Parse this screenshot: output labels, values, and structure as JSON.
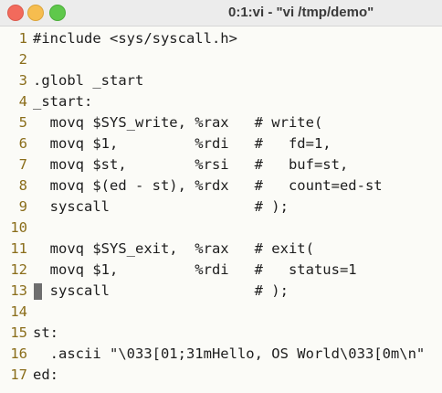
{
  "window": {
    "title": "0:1:vi - \"vi /tmp/demo\""
  },
  "editor": {
    "lines": [
      {
        "num": "1",
        "text": "#include <sys/syscall.h>"
      },
      {
        "num": "2",
        "text": ""
      },
      {
        "num": "3",
        "text": ".globl _start"
      },
      {
        "num": "4",
        "text": "_start:"
      },
      {
        "num": "5",
        "text": "  movq $SYS_write, %rax   # write("
      },
      {
        "num": "6",
        "text": "  movq $1,         %rdi   #   fd=1,"
      },
      {
        "num": "7",
        "text": "  movq $st,        %rsi   #   buf=st,"
      },
      {
        "num": "8",
        "text": "  movq $(ed - st), %rdx   #   count=ed-st"
      },
      {
        "num": "9",
        "text": "  syscall                 # );"
      },
      {
        "num": "10",
        "text": ""
      },
      {
        "num": "11",
        "text": "  movq $SYS_exit,  %rax   # exit("
      },
      {
        "num": "12",
        "text": "  movq $1,         %rdi   #   status=1"
      },
      {
        "num": "13",
        "text": "  syscall                 # );"
      },
      {
        "num": "14",
        "text": ""
      },
      {
        "num": "15",
        "text": "st:"
      },
      {
        "num": "16",
        "text": "  .ascii \"\\033[01;31mHello, OS World\\033[0m\\n\""
      },
      {
        "num": "17",
        "text": "ed:"
      }
    ],
    "cursor_line": "13"
  },
  "colors": {
    "line_number": "#8a6d1a",
    "code_text": "#1d1d1d",
    "background": "#fbfbf7",
    "close": "#f26a5c",
    "minimize": "#f6bd4f",
    "maximize": "#5fc84b"
  }
}
